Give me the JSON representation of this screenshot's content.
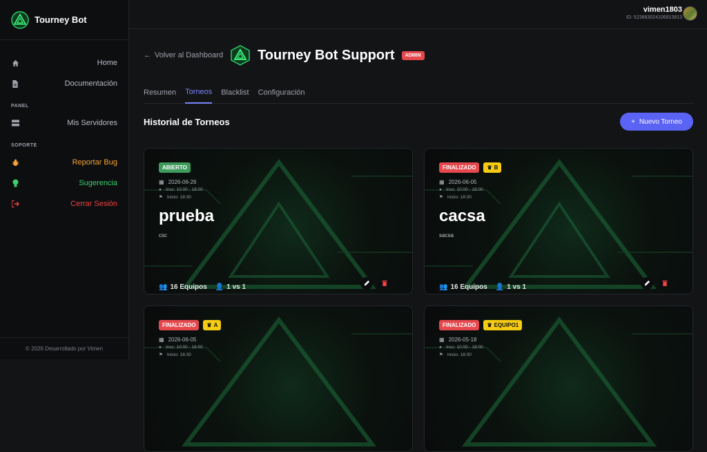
{
  "brand": {
    "name": "Tourney Bot"
  },
  "sidebar": {
    "items": [
      {
        "label": "Home",
        "icon": "home-icon"
      },
      {
        "label": "Documentación",
        "icon": "document-icon"
      }
    ],
    "panel_label": "PANEL",
    "panel_items": [
      {
        "label": "Mis Servidores",
        "icon": "server-icon"
      }
    ],
    "support_label": "SOPORTE",
    "support_items": [
      {
        "label": "Reportar Bug",
        "icon": "bug-icon",
        "color": "#f6a53a"
      },
      {
        "label": "Sugerencia",
        "icon": "lightbulb-icon",
        "color": "#3ecf6e"
      },
      {
        "label": "Cerrar Sesión",
        "icon": "logout-icon",
        "color": "#ef4444"
      }
    ],
    "footer": "© 2026 Desarrollado por Vimen"
  },
  "topbar": {
    "username": "vimen1803",
    "user_id": "ID: 523883024106913813"
  },
  "header": {
    "back": "Volver al Dashboard",
    "title": "Tourney Bot Support",
    "badge": "ADMIN"
  },
  "tabs": [
    {
      "label": "Resumen"
    },
    {
      "label": "Torneos",
      "active": true
    },
    {
      "label": "Blacklist"
    },
    {
      "label": "Configuración"
    }
  ],
  "section": {
    "title": "Historial de Torneos",
    "new_button": "Nuevo Torneo"
  },
  "cards": [
    {
      "status": "ABIERTO",
      "status_color": "#3f9b5c",
      "crown": "",
      "date": "2026-06-26",
      "insc": "Insc: 10:00 - 18:00",
      "inicio": "Inicio: 18:30",
      "name": "prueba",
      "desc": "csc",
      "teams": "16 Equipos",
      "mode": "1 vs 1"
    },
    {
      "status": "FINALIZADO",
      "status_color": "#e5484d",
      "crown": "B",
      "date": "2026-06-05",
      "insc": "Insc: 10:00 - 18:00",
      "inicio": "Inicio: 18:30",
      "name": "cacsa",
      "desc": "sacsa",
      "teams": "16 Equipos",
      "mode": "1 vs 1"
    },
    {
      "status": "FINALIZADO",
      "status_color": "#e5484d",
      "crown": "A",
      "date": "2026-06-05",
      "insc": "Insc: 10:00 - 18:00",
      "inicio": "Inicio: 18:30",
      "name": "",
      "desc": "",
      "teams": "",
      "mode": ""
    },
    {
      "status": "FINALIZADO",
      "status_color": "#e5484d",
      "crown": "EQUIPO1",
      "date": "2026-05-18",
      "insc": "Insc: 10:00 - 18:00",
      "inicio": "Inicio: 18:30",
      "name": "",
      "desc": "",
      "teams": "",
      "mode": ""
    }
  ]
}
